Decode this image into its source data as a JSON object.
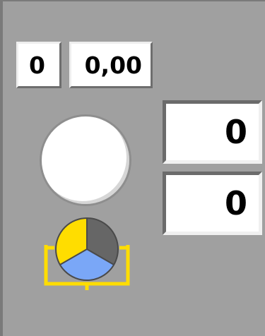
{
  "counters": {
    "small_left": {
      "value": "0"
    },
    "small_right": {
      "value": "0,00"
    },
    "big_top": {
      "value": "0"
    },
    "big_bottom": {
      "value": "0"
    }
  },
  "indicator": {
    "lamp_color": "#ffffff",
    "icon": "lamp-indicator"
  },
  "mixer": {
    "icon": "mixer-pie-icon",
    "segment_colors": [
      "#ffdd00",
      "#666666",
      "#7aa7f7"
    ],
    "bracket_color": "#ffdd00"
  },
  "colors": {
    "panel_background": "#a0a0a0"
  }
}
